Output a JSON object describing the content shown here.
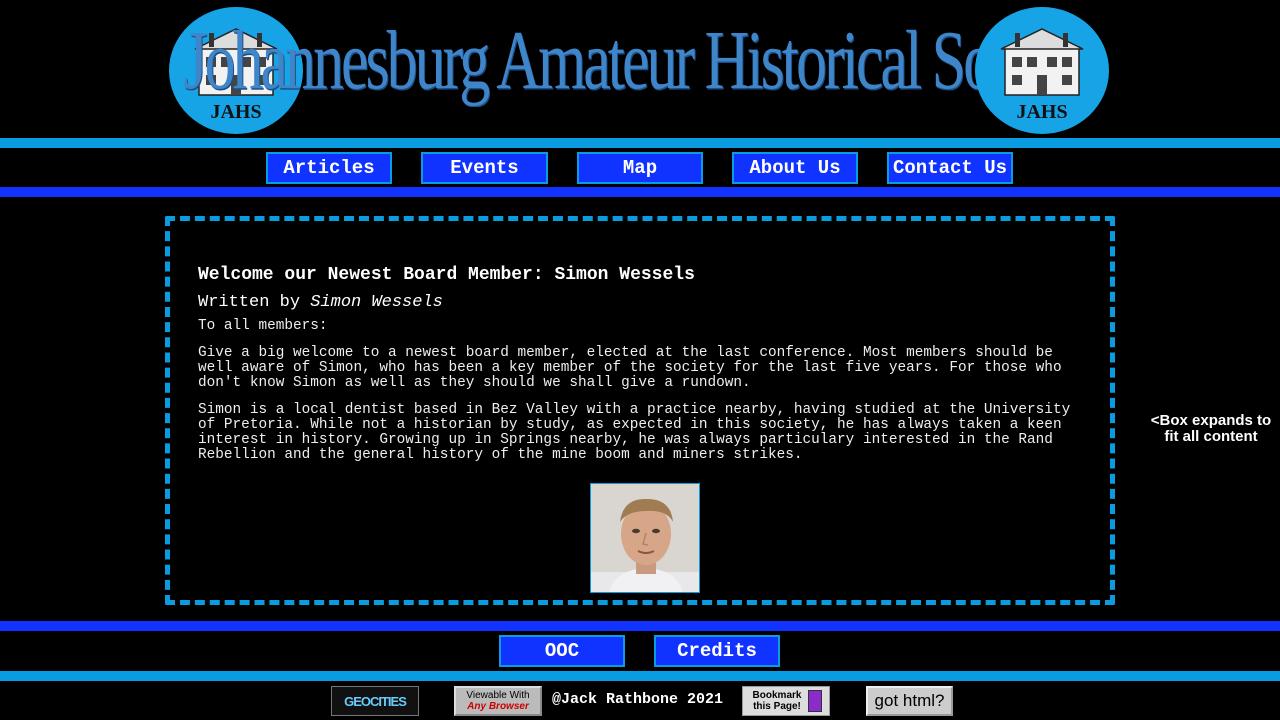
{
  "header": {
    "title": "Johannesburg Amateur Historical Society",
    "logo_text": "JAHS"
  },
  "nav": {
    "articles": "Articles",
    "events": "Events",
    "map": "Map",
    "about": "About Us",
    "contact": "Contact Us"
  },
  "article": {
    "title": "Welcome our Newest Board Member: Simon Wessels",
    "byline_prefix": "Written by",
    "author": "Simon Wessels",
    "greeting": "To all members:",
    "paragraph1": "Give a big welcome to a newest board member, elected at the last conference. Most members should be well aware of Simon, who has been a key member of the society for the last five years. For those who don't know Simon as well as they should we shall give a rundown.",
    "paragraph2": "Simon is a local dentist based in Bez Valley with a practice nearby, having studied at the University of Pretoria. While not a historian by study, as expected in this society, he has always taken a keen interest in history. Growing up in Springs nearby, he was always particulary interested in the Rand Rebellion and the general history of the mine boom and miners strikes."
  },
  "side_note": "<Box expands to fit all content",
  "footer_nav": {
    "ooc": "OOC",
    "credits": "Credits"
  },
  "footer": {
    "geocities": "GEOCITIES",
    "browser_line1": "Viewable With",
    "browser_line2": "Any Browser",
    "copyright": "@Jack Rathbone 2021",
    "bookmark": "Bookmark this Page!",
    "got_html": "got html?"
  },
  "colors": {
    "background": "#000000",
    "light_blue": "#0a9ce0",
    "button_blue": "#1133ff",
    "title_blue": "#3e86c9"
  }
}
